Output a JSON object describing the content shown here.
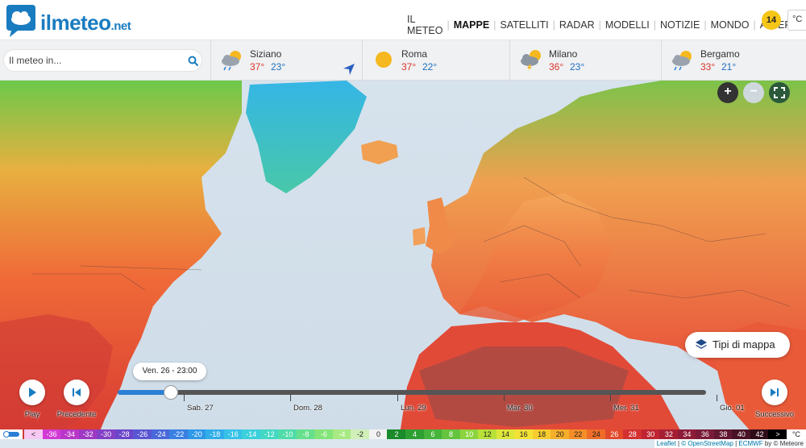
{
  "header": {
    "logo_main": "ilmeteo",
    "logo_suffix": ".net",
    "nav": [
      {
        "label": "IL METEO",
        "active": false
      },
      {
        "label": "MAPPE",
        "active": true
      },
      {
        "label": "SATELLITI",
        "active": false
      },
      {
        "label": "RADAR",
        "active": false
      },
      {
        "label": "MODELLI",
        "active": false
      },
      {
        "label": "NOTIZIE",
        "active": false
      },
      {
        "label": "MONDO",
        "active": false
      },
      {
        "label": "ALLERTE",
        "active": false
      }
    ],
    "alert_count": "14",
    "unit": "°C"
  },
  "search": {
    "placeholder": "Il meteo in..."
  },
  "cities": [
    {
      "name": "Siziano",
      "max": "37°",
      "min": "23°",
      "icon": "cloud-sun-rain-icon"
    },
    {
      "name": "Roma",
      "max": "37°",
      "min": "22°",
      "icon": "sun-icon"
    },
    {
      "name": "Milano",
      "max": "36°",
      "min": "23°",
      "icon": "cloud-sun-storm-icon"
    },
    {
      "name": "Bergamo",
      "max": "33°",
      "min": "21°",
      "icon": "cloud-sun-rain-icon"
    }
  ],
  "map_controls": {
    "zoom_in": "+",
    "zoom_out": "−"
  },
  "map_types_label": "Tipi di mappa",
  "timeline": {
    "current": "Ven. 26 - 23:00",
    "progress": 0.09,
    "days": [
      "Sab. 27",
      "Dom. 28",
      "Lun. 29",
      "Mar. 30",
      "Mer. 31",
      "Gio. 01"
    ],
    "play_label": "Play",
    "prev_label": "Precedente",
    "next_label": "Successivo"
  },
  "legend": {
    "toggle_icon": "toggle-icon",
    "unit": "°C",
    "values": [
      "<",
      "-36",
      "-34",
      "-32",
      "-30",
      "-28",
      "-26",
      "-24",
      "-22",
      "-20",
      "-18",
      "-16",
      "-14",
      "-12",
      "-10",
      "-8",
      "-6",
      "-4",
      "-2",
      "0",
      "2",
      "4",
      "6",
      "8",
      "10",
      "12",
      "14",
      "16",
      "18",
      "20",
      "22",
      "24",
      "26",
      "28",
      "30",
      "32",
      "34",
      "36",
      "38",
      "40",
      "42",
      ">"
    ],
    "colors": [
      "#f6c8f2",
      "#d23ad6",
      "#b936c9",
      "#9f37c4",
      "#8240c6",
      "#6b45ca",
      "#5a55d2",
      "#4968da",
      "#3a7fe2",
      "#2f98e8",
      "#31aeea",
      "#36c2e8",
      "#3bd0db",
      "#42d8c4",
      "#4fdca8",
      "#66e08c",
      "#84e47a",
      "#a8ea82",
      "#d0f0b8",
      "#f2f2f2",
      "#1a8a2a",
      "#2ea032",
      "#46b43a",
      "#64c43e",
      "#8cd43e",
      "#b8e038",
      "#dde63a",
      "#f3e236",
      "#f7cc2e",
      "#f7ae2a",
      "#f58e28",
      "#ef6c28",
      "#e34a2a",
      "#d43030",
      "#bf2430",
      "#a51f33",
      "#8e1c37",
      "#791a38",
      "#621730",
      "#4a1226",
      "#2e0c18",
      "#000000"
    ]
  },
  "attribution": {
    "leaflet": "Leaflet",
    "osm": "© OpenStreetMap",
    "ecmwf": "ECMWF",
    "meteo": "by © Meteore"
  },
  "colors": {
    "brand": "#1a7cc0",
    "alert": "#f5c518",
    "temp_max": "#d9362a",
    "temp_min": "#1f6fbf"
  }
}
